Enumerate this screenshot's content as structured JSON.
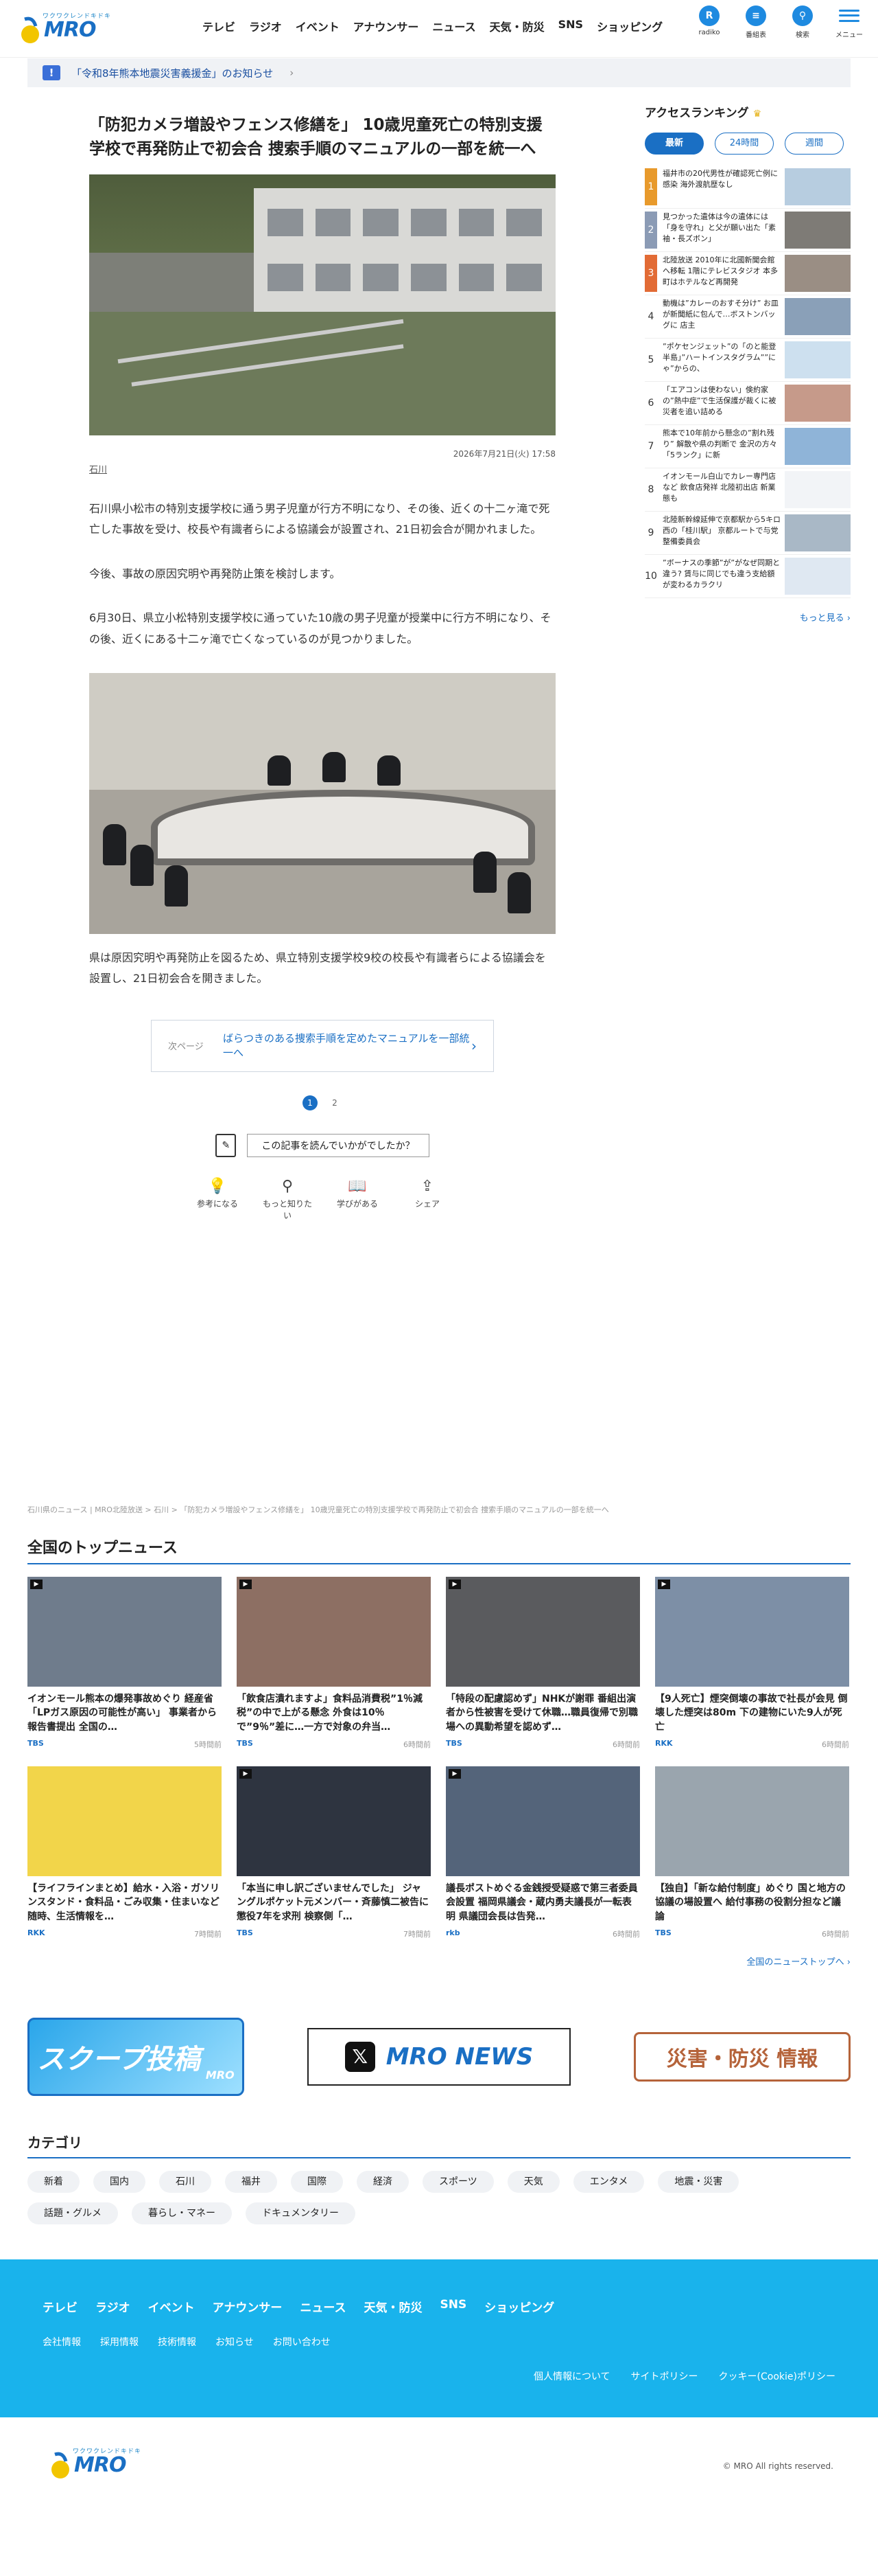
{
  "header": {
    "logo_catch": "ワクワクレンドキドキ",
    "logo_name": "MRO",
    "nav": [
      "テレビ",
      "ラジオ",
      "イベント",
      "アナウンサー",
      "ニュース",
      "天気・防災",
      "SNS",
      "ショッピング"
    ],
    "icons": [
      {
        "icon": "radiko-icon",
        "label": "radiko",
        "glyph": "R"
      },
      {
        "icon": "program-guide-icon",
        "label": "番組表",
        "glyph": "≡"
      },
      {
        "icon": "search-icon",
        "label": "検索",
        "glyph": "⚲"
      }
    ],
    "menu_label": "メニュー"
  },
  "notice": {
    "badge": "!",
    "text": "「令和8年熊本地震災害義援金」のお知らせ",
    "arrow": "›"
  },
  "article": {
    "title": "「防犯カメラ増設やフェンス修繕を」 10歳児童死亡の特別支援学校で再発防止で初会合 捜索手順のマニュアルの一部を統一へ",
    "date": "2026年7月21日(火) 17:58",
    "area": "石川",
    "paragraphs": [
      "石川県小松市の特別支援学校に通う男子児童が行方不明になり、その後、近くの十二ヶ滝で死亡した事故を受け、校長や有識者らによる協議会が設置され、21日初会合が開かれました。",
      "今後、事故の原因究明や再発防止策を検討します。",
      "6月30日、県立小松特別支援学校に通っていた10歳の男子児童が授業中に行方不明になり、その後、近くにある十二ヶ滝で亡くなっているのが見つかりました。"
    ],
    "caption": "県は原因究明や再発防止を図るため、県立特別支援学校9校の校長や有識者らによる協議会を設置し、21日初会合を開きました。",
    "next_label": "次ページ",
    "next_title": "ばらつきのある捜索手順を定めたマニュアルを一部統一へ",
    "next_arrow": "›",
    "pages": [
      "1",
      "2"
    ],
    "feedback_question": "この記事を読んでいかがでしたか？",
    "reactions": [
      {
        "icon": "lightbulb-icon",
        "glyph": "💡",
        "label": "参考になる"
      },
      {
        "icon": "search-icon",
        "glyph": "⚲",
        "label": "もっと知りたい"
      },
      {
        "icon": "book-icon",
        "glyph": "📖",
        "label": "学びがある"
      },
      {
        "icon": "share-icon",
        "glyph": "⇪",
        "label": "シェア"
      }
    ]
  },
  "ranking": {
    "title": "アクセスランキング",
    "tabs": [
      "最新",
      "24時間",
      "週間"
    ],
    "items": [
      {
        "rank": "1",
        "text": "福井市の20代男性が確認死亡例に感染 海外渡航歴なし"
      },
      {
        "rank": "2",
        "text": "見つかった遺体は今の遺体には「身を守れ」と父が願い出た「素袖・長ズボン」"
      },
      {
        "rank": "3",
        "text": "北陸放送 2010年に北國新聞会館へ移転 1階にテレビスタジオ 本多町はホテルなど再開発"
      },
      {
        "rank": "4",
        "text": "動機は”カレーのおすそ分け” お皿が新聞紙に包んで…ボストンバッグに 店主"
      },
      {
        "rank": "5",
        "text": "”ポケセンジェット”の「のと能登半島」”ハートインスタグラム””にゃ”からの、"
      },
      {
        "rank": "6",
        "text": "「エアコンは使わない」倹約家の”熱中症”で生活保護が裁くに被災者を追い詰める"
      },
      {
        "rank": "7",
        "text": "熊本で10年前から懸念の”割れ残り” 解散や県の判断で 金沢の方々「5ランク」に新"
      },
      {
        "rank": "8",
        "text": "イオンモール白山でカレー専門店など 飲食店発祥 北陸初出店 新業態も"
      },
      {
        "rank": "9",
        "text": "北陸新幹線延伸で京都駅から5キロ西の「桂川駅」 京都ルートで与党整備委員会"
      },
      {
        "rank": "10",
        "text": "”ボーナスの季節”が”がなぜ同期と違う? 賃与に同じでも違う支給額が変わるカラクリ"
      }
    ],
    "more": "もっと見る ›"
  },
  "breadcrumb": "石川県のニュース | MRO北陸放送 > 石川 > 「防犯カメラ増設やフェンス修繕を」 10歳児童死亡の特別支援学校で再発防止で初会合 捜索手順のマニュアルの一部を統一へ",
  "top_news": {
    "title": "全国のトップニュース",
    "items": [
      {
        "title": "イオンモール熊本の爆発事故めぐり 経産省「LPガス原因の可能性が高い」 事業者から報告書提出 全国の…",
        "src": "TBS",
        "time": "5時間前"
      },
      {
        "title": "「飲食店潰れますよ」食料品消費税”1％減税”の中で上がる懸念 外食は10％で”9％”差に…一方で対象の弁当…",
        "src": "TBS",
        "time": "6時間前"
      },
      {
        "title": "「特段の配慮認めず」NHKが謝罪 番組出演者から性被害を受けて休職…職員復帰で別職場への異動希望を認めず…",
        "src": "TBS",
        "time": "6時間前"
      },
      {
        "title": "【9人死亡】煙突倒壊の事故で社長が会見 倒壊した煙突は80m 下の建物にいた9人が死亡",
        "src": "RKK",
        "time": "6時間前"
      },
      {
        "title": "【ライフラインまとめ】給水・入浴・ガソリンスタンド・食料品・ごみ収集・住まいなど 随時、生活情報を…",
        "src": "RKK",
        "time": "7時間前"
      },
      {
        "title": "「本当に申し訳ございませんでした」 ジャングルポケット元メンバー・斉藤慎二被告に懲役7年を求刑 検察側「…",
        "src": "TBS",
        "time": "7時間前"
      },
      {
        "title": "議長ポストめぐる金銭授受疑惑で第三者委員会設置 福岡県議会・蔵内勇夫議長が一転表明 県議団会長は告発…",
        "src": "rkb",
        "time": "6時間前"
      },
      {
        "title": "【独自】「新な給付制度」めぐり 国と地方の協議の場設置へ 給付事務の役割分担など議論",
        "src": "TBS",
        "time": "6時間前"
      }
    ],
    "more": "全国のニューストップへ ›"
  },
  "banners": {
    "scoop": "スクープ投稿",
    "scoop_sub": "MRO",
    "x_glyph": "𝕏",
    "x_text": "MRO NEWS",
    "bousai": "災害・防災 情報"
  },
  "categories": {
    "title": "カテゴリ",
    "items": [
      "新着",
      "国内",
      "石川",
      "福井",
      "国際",
      "経済",
      "スポーツ",
      "天気",
      "エンタメ",
      "地震・災害",
      "話題・グルメ",
      "暮らし・マネー",
      "ドキュメンタリー"
    ]
  },
  "footer": {
    "nav": [
      "テレビ",
      "ラジオ",
      "イベント",
      "アナウンサー",
      "ニュース",
      "天気・防災",
      "SNS",
      "ショッピング"
    ],
    "sub": [
      "会社情報",
      "採用情報",
      "技術情報",
      "お知らせ",
      "お問い合わせ"
    ],
    "links": [
      "個人情報について",
      "サイトポリシー",
      "クッキー(Cookie)ポリシー"
    ],
    "copyright": "© MRO All rights reserved."
  },
  "colors": {
    "accent": "#1a6fc4",
    "footer": "#19b3ec",
    "rank1": "#e89a2c",
    "rank3": "#e26b35"
  }
}
